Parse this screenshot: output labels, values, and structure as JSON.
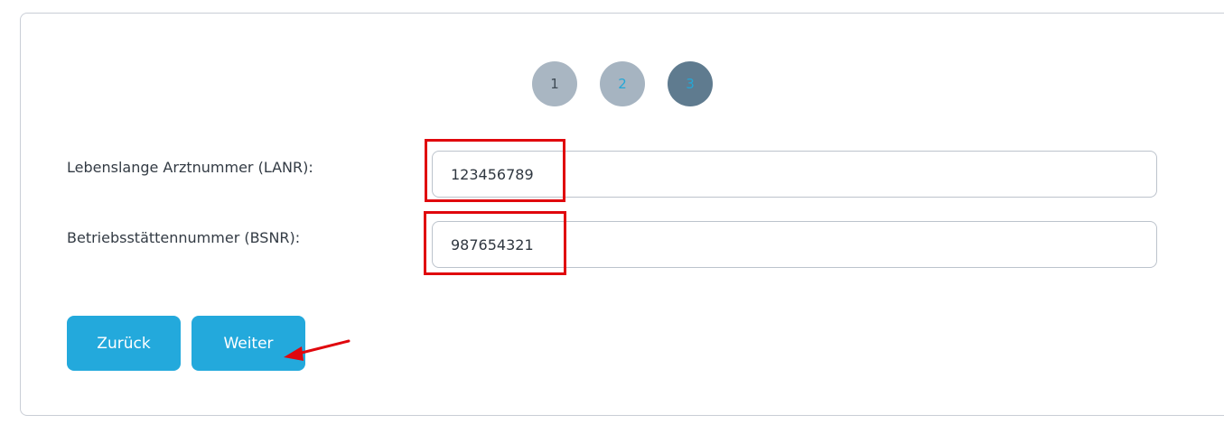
{
  "steps": [
    {
      "label": "1",
      "state": "done"
    },
    {
      "label": "2",
      "state": "done"
    },
    {
      "label": "3",
      "state": "active"
    }
  ],
  "form": {
    "lanr_label": "Lebenslange Arztnummer (LANR):",
    "lanr_value": "123456789",
    "bsnr_label": "Betriebsstättennummer (BSNR):",
    "bsnr_value": "987654321"
  },
  "buttons": {
    "back_label": "Zurück",
    "next_label": "Weiter"
  },
  "colors": {
    "button": "#23a9dc",
    "highlight": "#e0070d",
    "step_active": "#5f7b8f",
    "step_done": "#a9b6c2"
  }
}
